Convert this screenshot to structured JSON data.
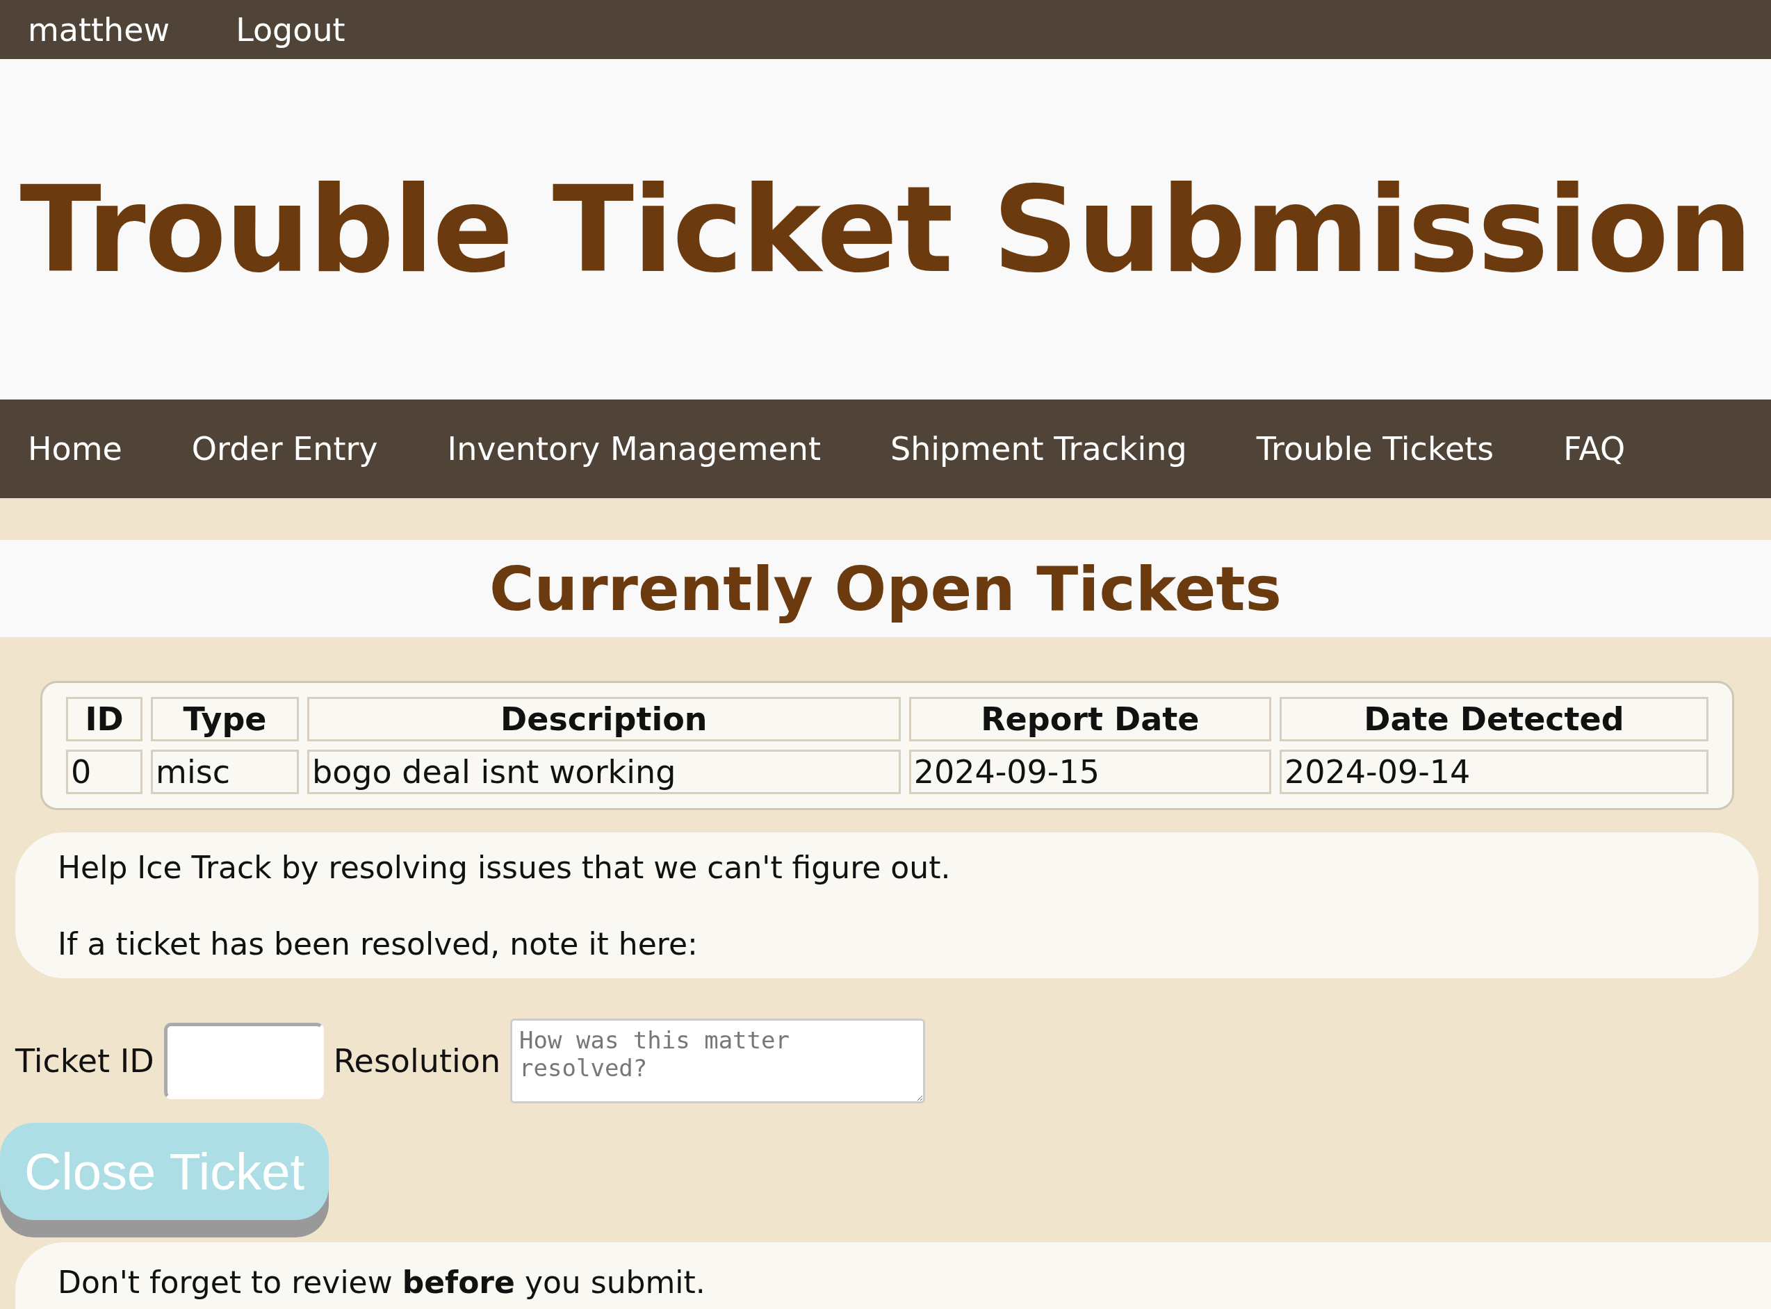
{
  "user_bar": {
    "username": "matthew",
    "logout": "Logout"
  },
  "header": {
    "title": "Trouble Ticket Submission"
  },
  "nav": [
    {
      "label": "Home"
    },
    {
      "label": "Order Entry"
    },
    {
      "label": "Inventory Management"
    },
    {
      "label": "Shipment Tracking"
    },
    {
      "label": "Trouble Tickets"
    },
    {
      "label": "FAQ"
    }
  ],
  "section_title": "Currently Open Tickets",
  "table": {
    "columns": [
      "ID",
      "Type",
      "Description",
      "Report Date",
      "Date Detected"
    ],
    "rows": [
      [
        "0",
        "misc",
        "bogo deal isnt working",
        "2024-09-15",
        "2024-09-14"
      ]
    ]
  },
  "info": [
    "Help Ice Track by resolving issues that we can't figure out.",
    "If a ticket has been resolved, note it here:"
  ],
  "form": {
    "ticket_id_label": "Ticket ID",
    "resolution_label": "Resolution",
    "resolution_placeholder": "How was this matter resolved?",
    "button": "Close Ticket"
  },
  "note": "Don't forget to review **before** you submit."
}
